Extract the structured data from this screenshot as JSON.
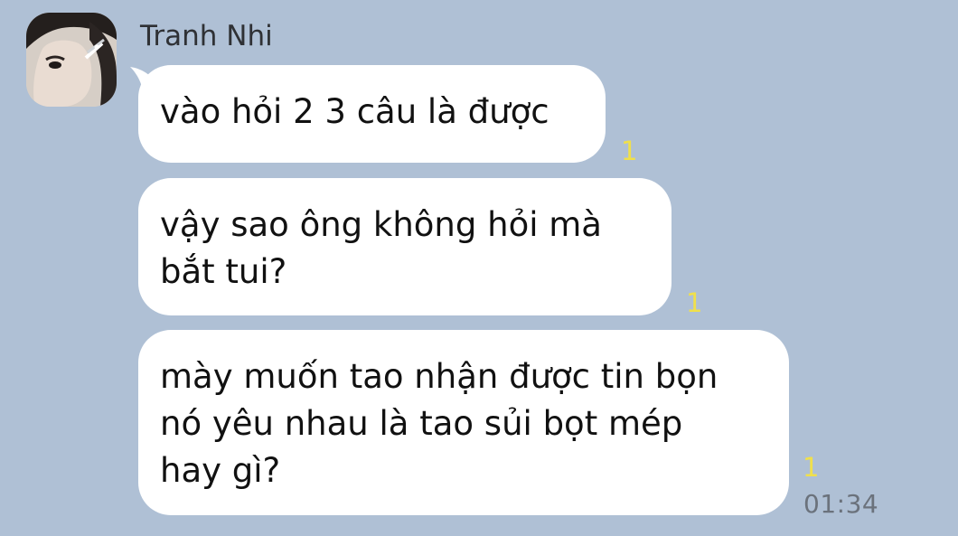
{
  "sender": {
    "name": "Tranh Nhi",
    "avatar": "profile-photo"
  },
  "messages": [
    {
      "lines": [
        "vào hỏi 2 3 câu là được"
      ],
      "read_count": "1"
    },
    {
      "lines": [
        "vậy sao ông không hỏi mà",
        "bắt tui?"
      ],
      "read_count": "1"
    },
    {
      "lines": [
        "mày muốn tao nhận được tin bọn",
        "nó yêu nhau là tao sủi bọt mép",
        "hay gì?"
      ],
      "read_count": "1"
    }
  ],
  "timestamp": "01:34",
  "colors": {
    "background": "#AFC0D5",
    "bubble": "#FFFFFF",
    "read_count": "#F0E04B",
    "timestamp": "#6B727C"
  }
}
